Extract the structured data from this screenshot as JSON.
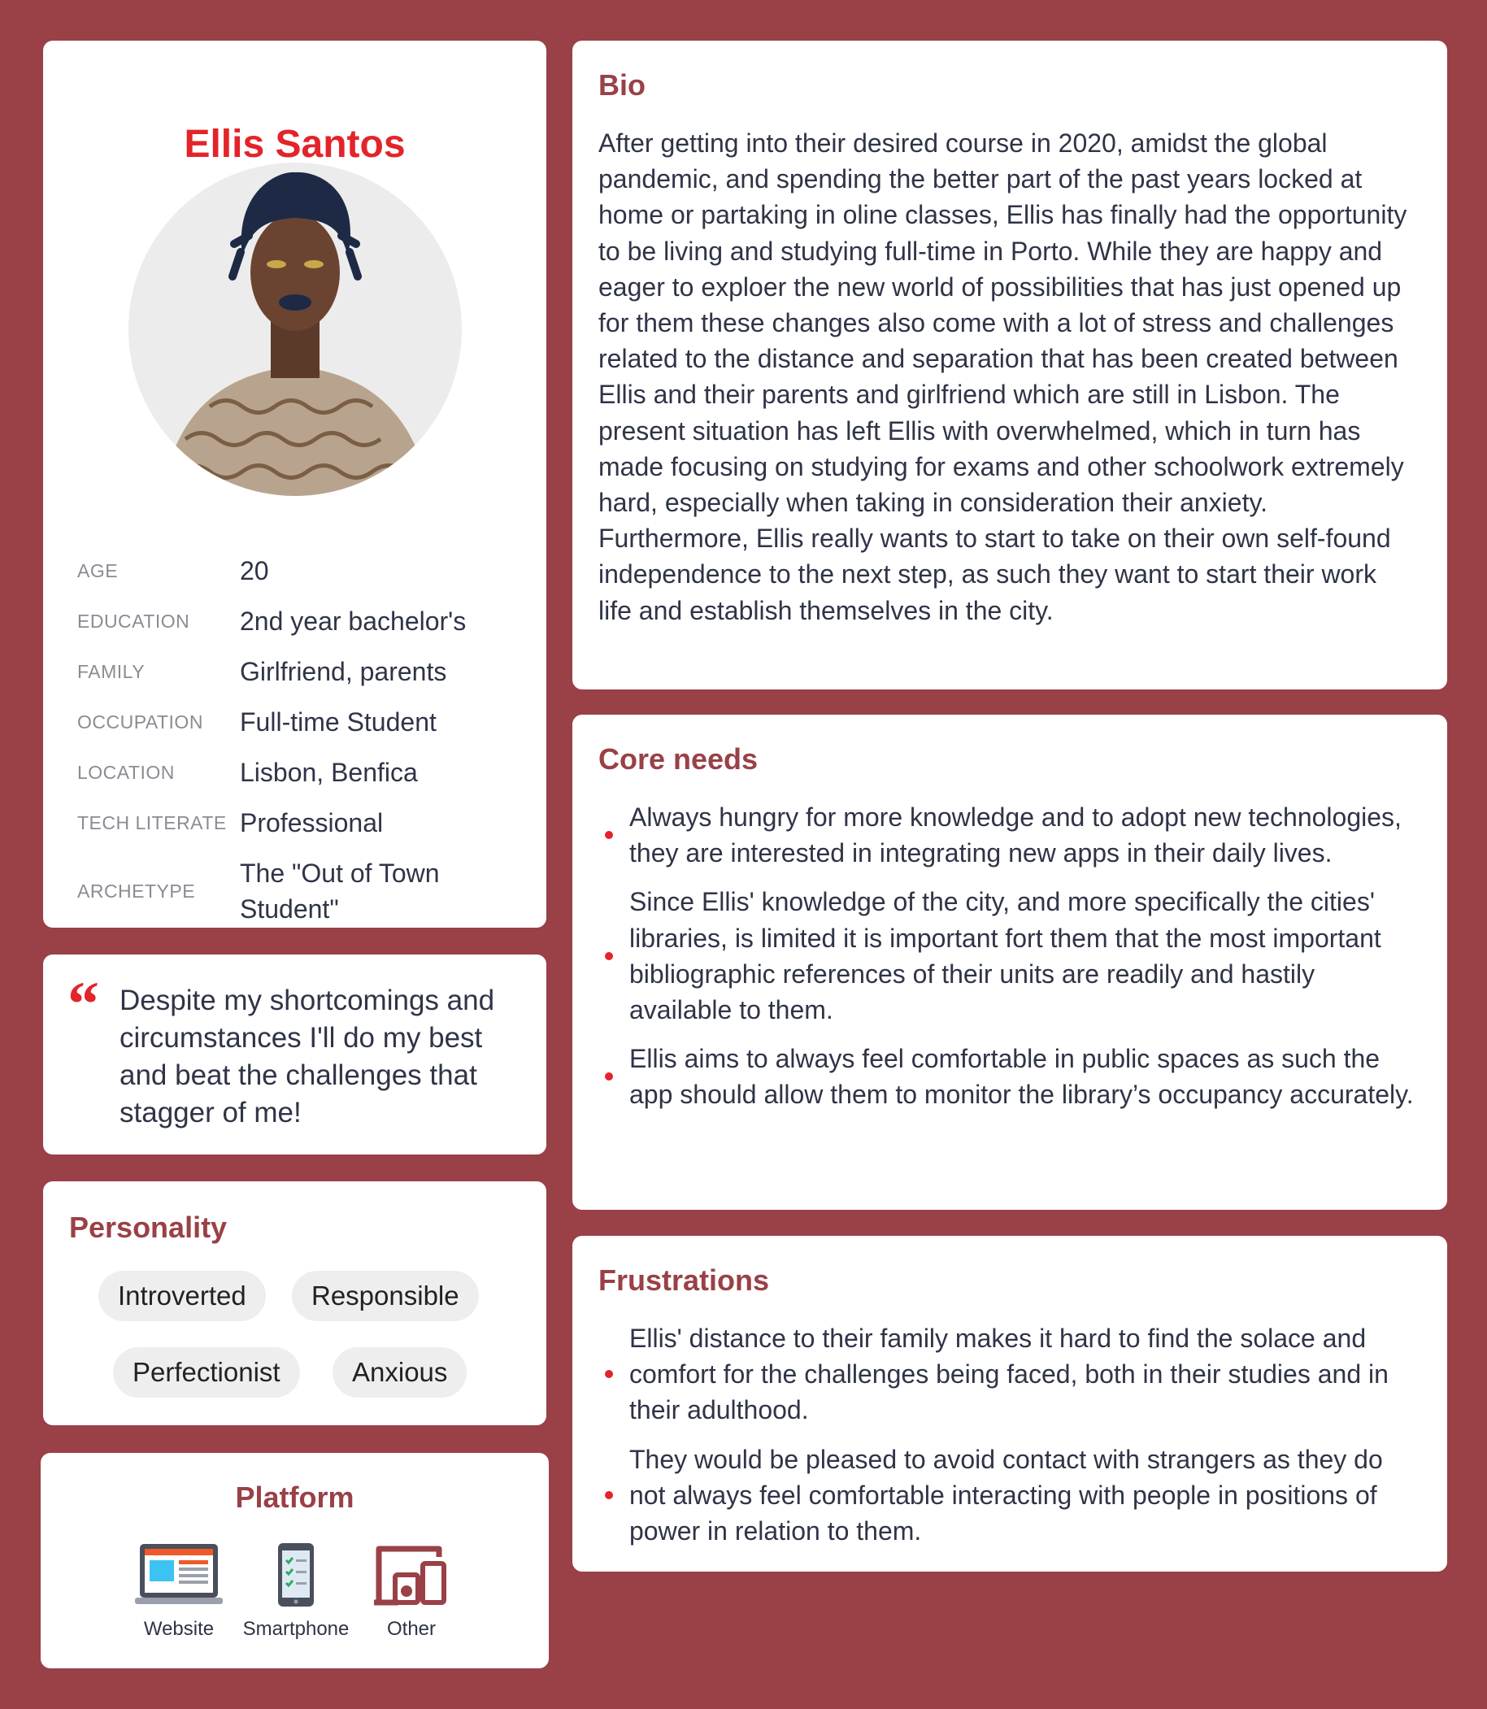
{
  "profile": {
    "name": "Ellis Santos",
    "facts": [
      {
        "label": "AGE",
        "value": "20"
      },
      {
        "label": "EDUCATION",
        "value": "2nd year bachelor's"
      },
      {
        "label": "FAMILY",
        "value": "Girlfriend, parents"
      },
      {
        "label": "OCCUPATION",
        "value": "Full-time Student"
      },
      {
        "label": "LOCATION",
        "value": "Lisbon, Benfica"
      },
      {
        "label": "TECH LITERATE",
        "value": "Professional"
      },
      {
        "label": "ARCHETYPE",
        "value": "The \"Out of Town Student\""
      }
    ]
  },
  "quote": {
    "mark": "“",
    "text": "Despite my shortcomings and circumstances I'll do my best and beat the challenges that stagger of me!"
  },
  "personality": {
    "title": "Personality",
    "tags": [
      "Introverted",
      "Responsible",
      "Perfectionist",
      "Anxious"
    ]
  },
  "platform": {
    "title": "Platform",
    "items": [
      {
        "label": "Website",
        "icon": "website-icon"
      },
      {
        "label": "Smartphone",
        "icon": "smartphone-icon"
      },
      {
        "label": "Other",
        "icon": "devices-icon"
      }
    ]
  },
  "bio": {
    "title": "Bio",
    "text": "After getting into their desired course in 2020, amidst the global pandemic, and spending the better part of the past years locked at home or partaking in oline classes, Ellis has finally had the opportunity to be living and studying full-time in Porto. While they are happy and eager to exploer the new world of possibilities that has just opened up for them these changes also come with a lot of stress and challenges related to the distance and separation that has been created between Ellis and their parents and girlfriend which are still in Lisbon. The present situation has left Ellis with overwhelmed, which in turn has made focusing on studying for exams and other schoolwork extremely hard, especially when taking in consideration their anxiety. Furthermore, Ellis really wants to start to take on their own self-found independence to the next step, as such they want to start their work life and establish themselves in the city."
  },
  "core_needs": {
    "title": "Core needs",
    "items": [
      "Always hungry for more knowledge and to adopt new technologies, they are interested in integrating new apps in their daily lives.",
      "Since Ellis' knowledge of the city, and more specifically the cities' libraries, is limited it is important fort them that the most important bibliographic references of their units are readily and hastily available to them.",
      "Ellis aims to always feel comfortable in public spaces as such the app should allow them to monitor the library’s occupancy accurately."
    ]
  },
  "frustrations": {
    "title": "Frustrations",
    "items": [
      "Ellis' distance to their family makes it hard to find the solace and comfort for the challenges being faced, both in their studies and in their adulthood.",
      "They would be pleased to avoid contact with strangers as they do not always feel comfortable interacting with people in positions of power in relation to them."
    ]
  },
  "colors": {
    "background": "#9a4047",
    "accent": "#e3242b",
    "heading": "#9a4047",
    "text": "#2f3447"
  }
}
